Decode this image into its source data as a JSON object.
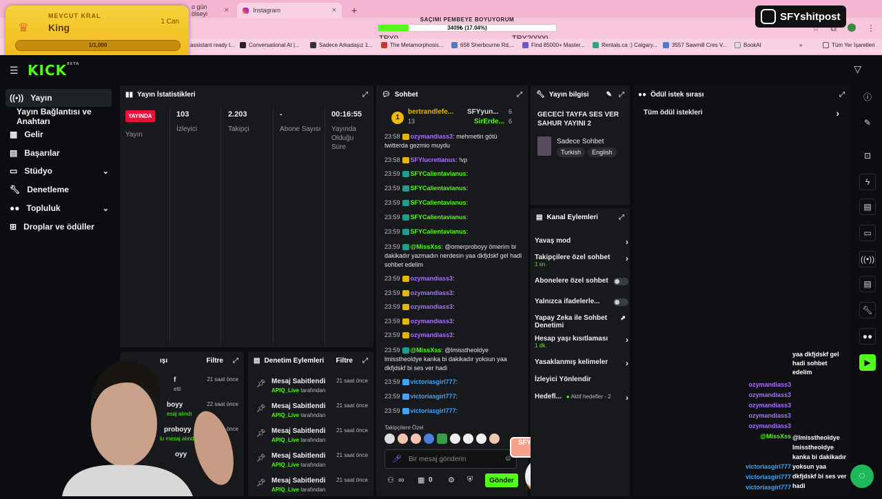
{
  "browser": {
    "tabs": [
      {
        "label": "o gün ölseyi",
        "active": false
      },
      {
        "label": "Instagram",
        "active": true
      }
    ],
    "overlay_goal": {
      "title": "SAÇIMI PEMBEYE BOYUYORUM",
      "progress_text": "3409₺ (17.04%)",
      "progress_fraction": 0.1704,
      "min_label": "TRY0",
      "max_label": "TRY20000"
    },
    "bookmarks": [
      "assistant ready t...",
      "Conversational AI |...",
      "Sadece Arkadaşız 1...",
      "The Metamorphosis...",
      "658 Sherbourne Rd,...",
      "Find 85000+ Master...",
      "Rentals.ca :) Calgary...",
      "3557 Sawmill Cres V...",
      "BookAI",
      "Tüm Yer İşaretleri"
    ]
  },
  "king_widget": {
    "label": "MEVCUT KRAL",
    "name": "King",
    "count": "1 Can",
    "progress": "1/1,000"
  },
  "channel_tag": "SFYshitpost",
  "sidebar": {
    "items": [
      {
        "label": "Yayın",
        "icon": "broadcast-icon"
      },
      {
        "label": "Yayın Bağlantısı ve Anahtarı",
        "icon": ""
      },
      {
        "label": "Gelir",
        "icon": "revenue-icon"
      },
      {
        "label": "Başarılar",
        "icon": "achievements-icon"
      },
      {
        "label": "Stüdyo",
        "icon": "studio-icon"
      },
      {
        "label": "Denetleme",
        "icon": "wrench-icon"
      },
      {
        "label": "Topluluk",
        "icon": "community-icon"
      },
      {
        "label": "Droplar ve ödüller",
        "icon": "drops-icon"
      }
    ]
  },
  "stats": {
    "title": "Yayın İstatistikleri",
    "status_badge": "YAYINDA",
    "status_label": "Yayın",
    "viewers": {
      "value": "103",
      "label": "İzleyici"
    },
    "followers": {
      "value": "2.203",
      "label": "Takipçi"
    },
    "subs": {
      "value": "-",
      "label": "Abone Sayısı"
    },
    "uptime": {
      "value": "00:16:55",
      "label": "Yayında Olduğu Süre"
    }
  },
  "chat": {
    "title": "Sohbet",
    "pinned": [
      {
        "user": "bertrandlefe...",
        "count": "13"
      },
      {
        "user": "SFYyun...",
        "count": "6"
      },
      {
        "user": "SirErde...",
        "count": "6"
      }
    ],
    "messages": [
      {
        "time": "23:58",
        "user": "ozymandiass3",
        "color": "pur",
        "text": ": mehmetin götü twitterda gezmio muydu"
      },
      {
        "time": "23:58",
        "user": "SFYlucretianus",
        "color": "pur",
        "text": ": !vp"
      },
      {
        "time": "23:59",
        "user": "SFYCalientavianus",
        "color": "grn",
        "text": ":"
      },
      {
        "time": "23:59",
        "user": "SFYCalientavianus",
        "color": "grn",
        "text": ":"
      },
      {
        "time": "23:59",
        "user": "SFYCalientavianus",
        "color": "grn",
        "text": ":"
      },
      {
        "time": "23:59",
        "user": "SFYCalientavianus",
        "color": "grn",
        "text": ":"
      },
      {
        "time": "23:59",
        "user": "SFYCalientavianus",
        "color": "grn",
        "text": ":"
      },
      {
        "time": "23:59",
        "user": "@MissXss",
        "color": "grn",
        "text": ": @omerproboyy ömerim bi dakikadır yazmadın nerdesin yaa dkfjdskf gel hadi sohbet edelim"
      },
      {
        "time": "23:59",
        "user": "ozymandiass3",
        "color": "pur",
        "text": ":"
      },
      {
        "time": "23:59",
        "user": "ozymandiass3",
        "color": "pur",
        "text": ":"
      },
      {
        "time": "23:59",
        "user": "ozymandiass3",
        "color": "pur",
        "text": ":"
      },
      {
        "time": "23:59",
        "user": "ozymandiass3",
        "color": "pur",
        "text": ":"
      },
      {
        "time": "23:59",
        "user": "ozymandiass3",
        "color": "pur",
        "text": ":"
      },
      {
        "time": "23:59",
        "user": "@MissXss",
        "color": "grn",
        "text": ": @lmisstheoldye lmisstheoldye kanka bi dakikadır yoksun yaa dkfjdskf bi ses ver hadi"
      },
      {
        "time": "23:59",
        "user": "victoriasgirl777",
        "color": "blu",
        "text": ":"
      },
      {
        "time": "23:59",
        "user": "victoriasgirl777",
        "color": "blu",
        "text": ":"
      },
      {
        "time": "23:59",
        "user": "victoriasgirl777",
        "color": "blu",
        "text": ":"
      }
    ],
    "emote_label": "Takipçilere Özel",
    "input_placeholder": "Bir mesaj gönderin",
    "count": "0",
    "send_label": "Gönder"
  },
  "stream_info": {
    "title": "Yayın bilgisi",
    "stream_title": "GECECİ TAYFA SES VER SAHUR YAYINI 2",
    "category": "Sadece Sohbet",
    "tags": [
      "Turkish",
      "English"
    ]
  },
  "channel_actions": {
    "title": "Kanal Eylemleri",
    "rows": [
      {
        "label": "Yavaş mod",
        "sub": "",
        "control": "arrow"
      },
      {
        "label": "Takipçilere özel sohbet",
        "sub": "1 sn.",
        "control": "arrow"
      },
      {
        "label": "Abonelere özel sohbet",
        "sub": "",
        "control": "toggle"
      },
      {
        "label": "Yalnızca ifadelerle...",
        "sub": "",
        "control": "toggle"
      },
      {
        "label": "Yapay Zeka ile Sohbet Denetimi",
        "sub": "",
        "control": "external"
      },
      {
        "label": "Hesap yaşı kısıtlaması",
        "sub": "1 dk.",
        "control": "arrow"
      },
      {
        "label": "Yasaklanmış kelimeler",
        "sub": "",
        "control": "arrow"
      },
      {
        "label": "İzleyici Yönlendir",
        "sub": "",
        "control": "none"
      },
      {
        "label": "Hedefl...",
        "sub": "",
        "control": "arrow",
        "extra": "Aktif hedefler - 2"
      }
    ]
  },
  "rewards": {
    "title": "Ödül istek sırası",
    "item": "Tüm ödül istekleri"
  },
  "activity": {
    "title_partial": "ışı",
    "filter": "Filtre",
    "rows": [
      {
        "name": "f",
        "sub": "etti",
        "time": "21 saat önce"
      },
      {
        "name": "boyy",
        "sub": "esaj alındı",
        "time": "22 saat önce"
      },
      {
        "name": "proboyy",
        "sub": "lu mesaj alındı",
        "time": "21 saat önce"
      },
      {
        "name": "oyy",
        "sub": "",
        "time": ""
      },
      {
        "name": "",
        "sub": "",
        "time": ""
      }
    ]
  },
  "mod_actions": {
    "title": "Denetim Eylemleri",
    "filter": "Filtre",
    "rows": [
      {
        "title": "Mesaj Sabitlendi",
        "user": "APIQ_Live",
        "by": "tarafından",
        "time": "21 saat önce"
      },
      {
        "title": "Mesaj Sabitlendi",
        "user": "APIQ_Live",
        "by": "tarafından",
        "time": "21 saat önce"
      },
      {
        "title": "Mesaj Sabitlendi",
        "user": "APIQ_Live",
        "by": "tarafından",
        "time": "21 saat önce"
      },
      {
        "title": "Mesaj Sabitlendi",
        "user": "APIQ_Live",
        "by": "tarafından",
        "time": "21 saat önce"
      },
      {
        "title": "Mesaj Sabitlendi",
        "user": "APIQ_Live",
        "by": "tarafından",
        "time": "21 saat önce"
      }
    ]
  },
  "stream_overlay_chat": {
    "lines": [
      {
        "text": "yaa dkfjdskf gel hadi sohbet edelim",
        "color": "#ffffff"
      },
      {
        "text": "ozymandiass3",
        "color": "#a970ff"
      },
      {
        "text": "ozymandiass3",
        "color": "#a970ff"
      },
      {
        "text": "ozymandiass3",
        "color": "#a970ff"
      },
      {
        "text": "ozymandiass3",
        "color": "#a970ff"
      },
      {
        "text": "ozymandiass3",
        "color": "#a970ff"
      },
      {
        "text": "@MissXss",
        "color": "#53fc18"
      },
      {
        "text": "victoriasgirl777",
        "color": "#3ea6ff"
      },
      {
        "text": "victoriasgirl777",
        "color": "#3ea6ff"
      },
      {
        "text": "victoriasgirl777",
        "color": "#3ea6ff"
      }
    ],
    "missxss_text": "@lmisstheoldye lmisstheoldye kanka bi dakikadır yoksun yaa dkfjdskf bi ses ver hadi"
  },
  "prediction_widget": {
    "user": "SFYlucretianus",
    "percent": "95%"
  },
  "colors": {
    "kick_green": "#53fc18",
    "live_red": "#e9113c",
    "panel_bg": "#18191c",
    "page_bg": "#0b0d10",
    "pink_browser": "#f3b5d1"
  }
}
